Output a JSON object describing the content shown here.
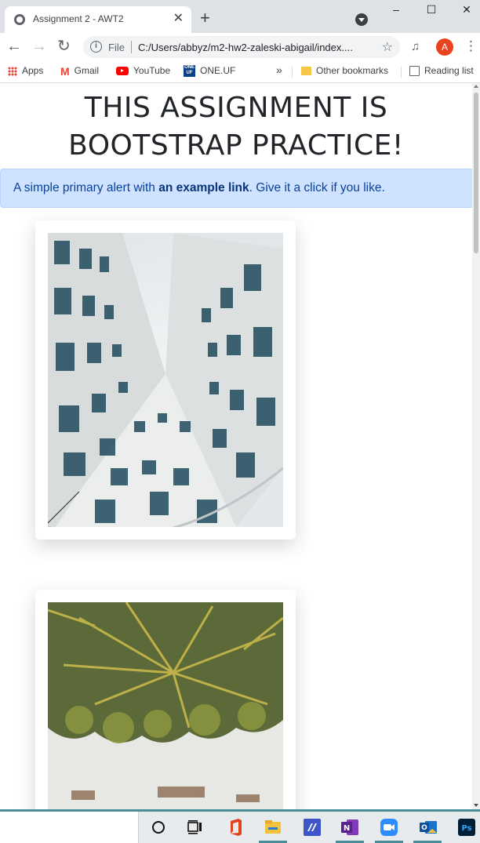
{
  "browser": {
    "tab_title": "Assignment 2 - AWT2",
    "tab_close": "✕",
    "new_tab": "+",
    "window_min": "–",
    "window_max": "☐",
    "window_close": "✕",
    "back": "←",
    "forward": "→",
    "reload": "↻",
    "omnibox_info": "i",
    "omnibox_scheme": "File",
    "url": "C:/Users/abbyz/m2-hw2-zaleski-abigail/index....",
    "star": "☆",
    "profile_initial": "A",
    "menu": "⋮",
    "media": "♫"
  },
  "bookmarks": {
    "items": [
      {
        "label": "Apps",
        "icon": "apps-grid-icon"
      },
      {
        "label": "Gmail",
        "icon": "gmail-icon"
      },
      {
        "label": "YouTube",
        "icon": "youtube-icon"
      },
      {
        "label": "ONE.UF",
        "icon": "oneuf-icon"
      }
    ],
    "overflow": "»",
    "other": "Other bookmarks",
    "reading_list": "Reading list"
  },
  "page": {
    "title": "THIS ASSIGNMENT IS BOOTSTRAP PRACTICE!",
    "alert_prefix": "A simple primary alert with ",
    "alert_link": "an example link",
    "alert_suffix": ". Give it a click if you like."
  },
  "colors": {
    "alert_bg": "#cfe2ff",
    "alert_text": "#084298",
    "profile": "#e8431d",
    "taskbar_accent": "#4a8d97"
  },
  "taskbar": {
    "icons": [
      "cortana-icon",
      "task-view-icon",
      "office-icon",
      "file-explorer-icon",
      "visual-studio-icon",
      "onenote-icon",
      "zoom-icon",
      "outlook-icon",
      "photoshop-icon"
    ]
  }
}
